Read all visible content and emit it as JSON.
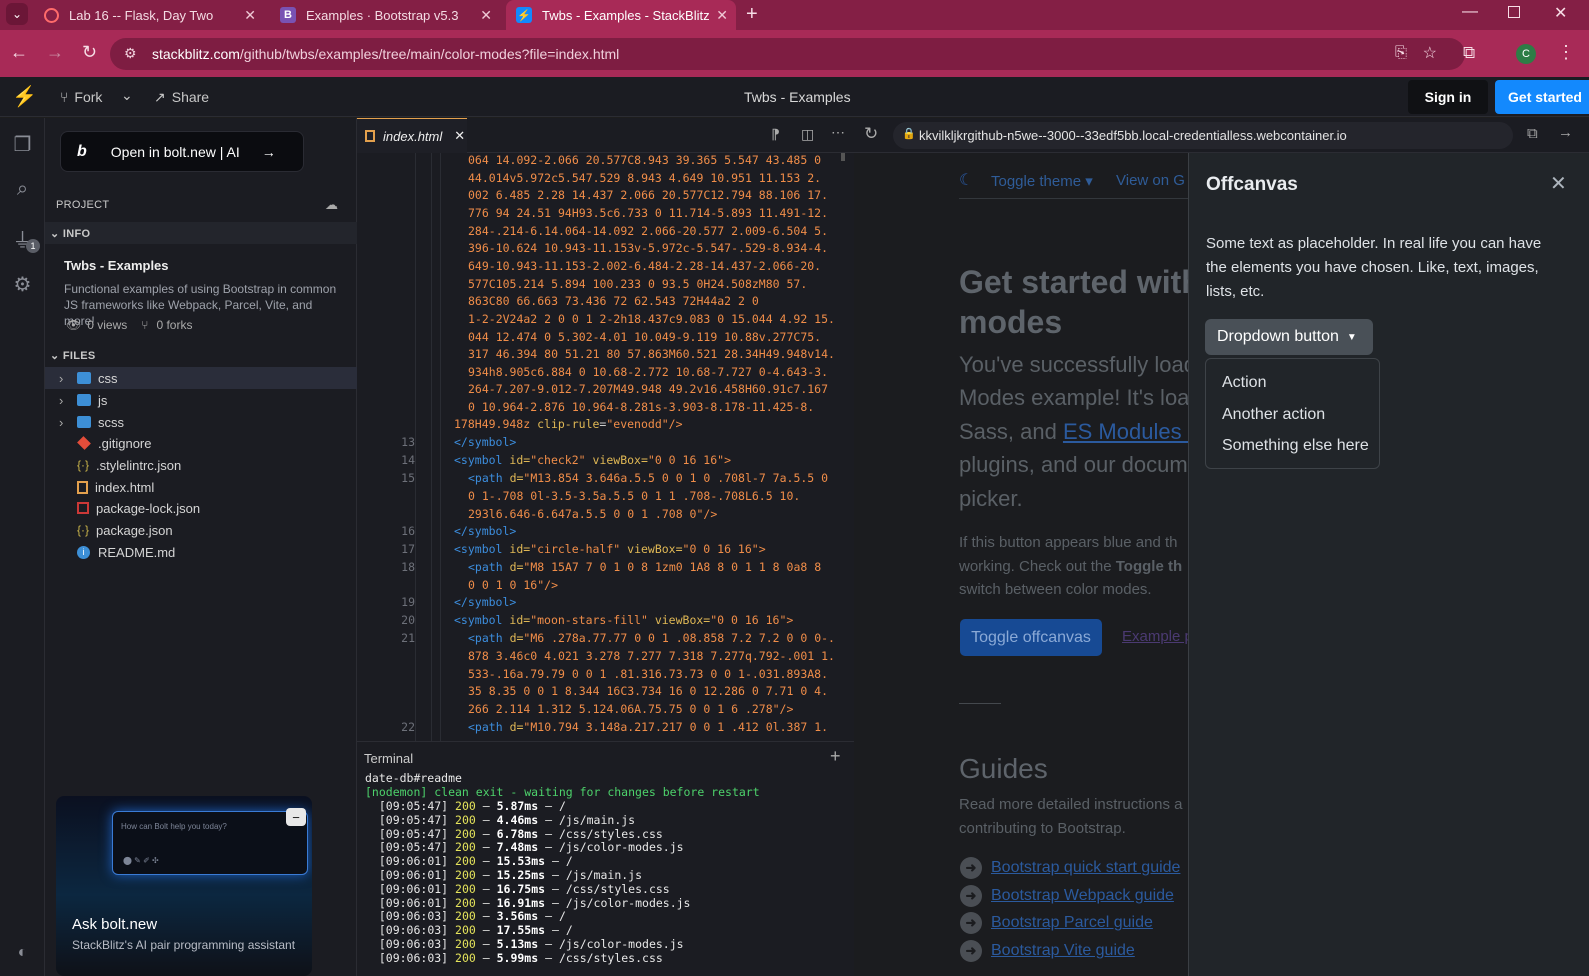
{
  "browser": {
    "tabs": [
      {
        "title": "Lab 16 -- Flask, Day Two",
        "icon": "loading-spinner-icon"
      },
      {
        "title": "Examples · Bootstrap v5.3",
        "icon": "bootstrap-icon"
      },
      {
        "title": "Twbs - Examples - StackBlitz",
        "icon": "stackblitz-icon"
      }
    ],
    "url_domain": "stackblitz.com",
    "url_path": "/github/twbs/examples/tree/main/color-modes?file=index.html",
    "profile_initial": "C"
  },
  "header": {
    "fork": "Fork",
    "share": "Share",
    "title": "Twbs - Examples",
    "signin": "Sign in",
    "getstarted": "Get started"
  },
  "sidebar": {
    "bolt_button": "Open in bolt.new | AI",
    "project": "PROJECT",
    "info": "INFO",
    "project_name": "Twbs - Examples",
    "description": "Functional examples of using Bootstrap in common JS frameworks like Webpack, Parcel, Vite, and more!",
    "views": "0 views",
    "forks": "0 forks",
    "files": "FILES",
    "file_list": [
      {
        "name": "css",
        "type": "folder"
      },
      {
        "name": "js",
        "type": "folder"
      },
      {
        "name": "scss",
        "type": "folder"
      },
      {
        "name": ".gitignore",
        "type": "git"
      },
      {
        "name": ".stylelintrc.json",
        "type": "json"
      },
      {
        "name": "index.html",
        "type": "html"
      },
      {
        "name": "package-lock.json",
        "type": "npm"
      },
      {
        "name": "package.json",
        "type": "json"
      },
      {
        "name": "README.md",
        "type": "info"
      }
    ],
    "badge": "1",
    "card_input_placeholder": "How can Bolt help you today?",
    "card_title": "Ask bolt.new",
    "card_sub": "StackBlitz's AI pair programming assistant"
  },
  "editor": {
    "tab": "index.html",
    "path_lines": [
      "064 14.092-2.066 20.577C8.943 39.365 5.547 43.485 0",
      "44.014v5.972c5.547.529 8.943 4.649 10.951 11.153 2.",
      "002 6.485 2.28 14.437 2.066 20.577C12.794 88.106 17.",
      "776 94 24.51 94H93.5c6.733 0 11.714-5.893 11.491-12.",
      "284-.214-6.14.064-14.092 2.066-20.577 2.009-6.504 5.",
      "396-10.624 10.943-11.153v-5.972c-5.547-.529-8.934-4.",
      "649-10.943-11.153-2.002-6.484-2.28-14.437-2.066-20.",
      "577C105.214 5.894 100.233 0 93.5 0H24.508zM80 57.",
      "863C80 66.663 73.436 72 62.543 72H44a2 2 0",
      "1-2-2V24a2 2 0 0 1 2-2h18.437c9.083 0 15.044 4.92 15.",
      "044 12.474 0 5.302-4.01 10.049-9.119 10.88v.277C75.",
      "317 46.394 80 51.21 80 57.863M60.521 28.34H49.948v14.",
      "934h8.905c6.884 0 10.68-2.772 10.68-7.727 0-4.643-3.",
      "264-7.207-9.012-7.207M49.948 49.2v16.458H60.91c7.167",
      "0 10.964-2.876 10.964-8.281s-3.903-8.178-11.425-8.",
      "178H49.948z"
    ],
    "clip_attr": "clip-rule",
    "clip_val": "\"evenodd\"/>",
    "l13": "</symbol>",
    "l14_id": "\"check2\"",
    "l14_vb": "\"0 0 16 16\">",
    "l15a": "\"M13.854 3.646a.5.5 0 0 1 0 .708l-7 7a.5.5 0",
    "l15b": "0 1-.708 0l-3.5-3.5a.5.5 0 1 1 .708-.708L6.5 10.",
    "l15c": "293l6.646-6.647a.5.5 0 0 1 .708 0\"/>",
    "l16": "</symbol>",
    "l17_id": "\"circle-half\"",
    "l17_vb": "\"0 0 16 16\">",
    "l18a": "\"M8 15A7 7 0 1 0 8 1zm0 1A8 8 0 1 1 8 0a8 8",
    "l18b": "0 0 1 0 16\"/>",
    "l19": "</symbol>",
    "l20_id": "\"moon-stars-fill\"",
    "l20_vb": "\"0 0 16 16\">",
    "l21a": "\"M6 .278a.77.77 0 0 1 .08.858 7.2 7.2 0 0 0-.",
    "l21b": "878 3.46c0 4.021 3.278 7.277 7.318 7.277q.792-.001 1.",
    "l21c": "533-.16a.79.79 0 0 1 .81.316.73.73 0 0 1-.031.893A8.",
    "l21d": "35 8.35 0 0 1 8.344 16C3.734 16 0 12.286 0 7.71 0 4.",
    "l21e": "266 2.114 1.312 5.124.06A.75.75 0 0 1 6 .278\"/>",
    "l22": "\"M10.794 3.148a.217.217 0 0 1 .412 0l.387 1.",
    "symbol_open": "<symbol",
    "symbol_id": "id=",
    "viewbox": "viewBox=",
    "path_open": "<path",
    "d_attr": "d=",
    "line_numbers": [
      "13",
      "14",
      "15",
      "16",
      "17",
      "18",
      "19",
      "20",
      "21",
      "22"
    ]
  },
  "terminal": {
    "title": "Terminal",
    "first": "date-db#readme",
    "nodemon": "[nodemon] clean exit - waiting for changes before restart",
    "logs": [
      {
        "t": "[09:05:47]",
        "code": "200",
        "ms": "5.87ms",
        "path": "/"
      },
      {
        "t": "[09:05:47]",
        "code": "200",
        "ms": "4.46ms",
        "path": "/js/main.js"
      },
      {
        "t": "[09:05:47]",
        "code": "200",
        "ms": "6.78ms",
        "path": "/css/styles.css"
      },
      {
        "t": "[09:05:47]",
        "code": "200",
        "ms": "7.48ms",
        "path": "/js/color-modes.js"
      },
      {
        "t": "[09:06:01]",
        "code": "200",
        "ms": "15.53ms",
        "path": "/"
      },
      {
        "t": "[09:06:01]",
        "code": "200",
        "ms": "15.25ms",
        "path": "/js/main.js"
      },
      {
        "t": "[09:06:01]",
        "code": "200",
        "ms": "16.75ms",
        "path": "/css/styles.css"
      },
      {
        "t": "[09:06:01]",
        "code": "200",
        "ms": "16.91ms",
        "path": "/js/color-modes.js"
      },
      {
        "t": "[09:06:03]",
        "code": "200",
        "ms": "3.56ms",
        "path": "/"
      },
      {
        "t": "[09:06:03]",
        "code": "200",
        "ms": "17.55ms",
        "path": "/"
      },
      {
        "t": "[09:06:03]",
        "code": "200",
        "ms": "5.13ms",
        "path": "/js/color-modes.js"
      },
      {
        "t": "[09:06:03]",
        "code": "200",
        "ms": "5.99ms",
        "path": "/css/styles.css"
      }
    ]
  },
  "preview": {
    "url": "kkvilkljkrgithub-n5we--3000--33edf5bb.local-credentialless.webcontainer.io",
    "toggle_theme": "Toggle theme",
    "view_on": "View on G",
    "heading1": "Get started with",
    "heading2": "modes",
    "lead1": "You've successfully load",
    "lead2": "Modes example! It's loa",
    "lead3a": "Sass, and ",
    "lead3b": "ES Modules S",
    "lead4": "plugins, and our docum",
    "lead5": "picker.",
    "p1": "If this button appears blue and th",
    "p2a": "working. Check out the ",
    "p2b": "Toggle th",
    "p3": "switch between color modes.",
    "toggle_offcanvas": "Toggle offcanvas",
    "example_link": "Example p",
    "guides": "Guides",
    "guides_p1": "Read more detailed instructions a",
    "guides_p2": "contributing to Bootstrap.",
    "guide_links": [
      "Bootstrap quick start guide",
      "Bootstrap Webpack guide",
      "Bootstrap Parcel guide",
      "Bootstrap Vite guide"
    ]
  },
  "offcanvas": {
    "title": "Offcanvas",
    "text": "Some text as placeholder. In real life you can have the elements you have chosen. Like, text, images, lists, etc.",
    "dropdown": "Dropdown button",
    "items": [
      "Action",
      "Another action",
      "Something else here"
    ]
  },
  "colors": {
    "chrome_tab_bg": "#841f45",
    "chrome_active": "#a82a57",
    "accent_blue": "#1389fd",
    "bootstrap_blue": "#0d6efd"
  }
}
